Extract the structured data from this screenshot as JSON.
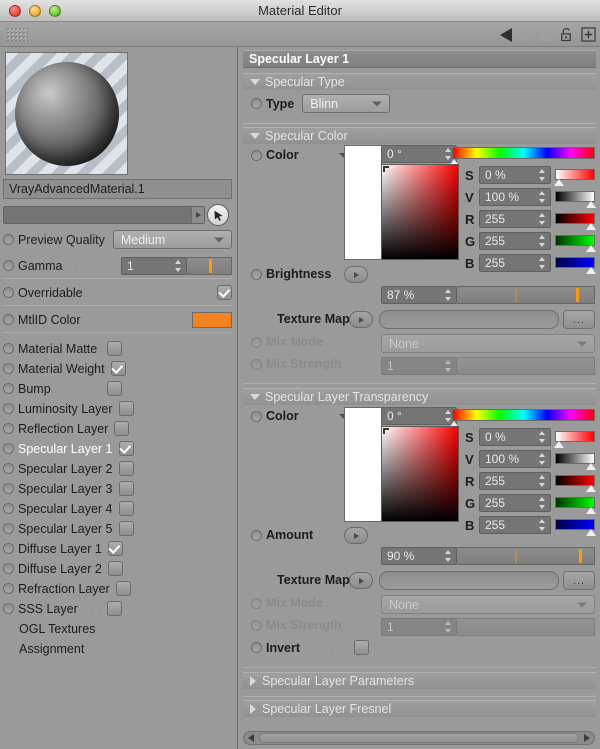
{
  "window": {
    "title": "Material Editor",
    "controls": [
      "close",
      "minimize",
      "zoom"
    ]
  },
  "toolbar": {
    "back_icon": "back-arrow-icon",
    "forward_icon": "forward-arrow-icon",
    "up_icon": "up-arrow-icon",
    "lock_icon": "lock-icon",
    "add_icon": "plus-icon"
  },
  "left_panel": {
    "material_name": "VrayAdvancedMaterial.1",
    "search_placeholder": "",
    "search_value": "",
    "preview_quality": {
      "label": "Preview Quality",
      "value": "Medium"
    },
    "gamma": {
      "label": "Gamma",
      "value": "1"
    },
    "overridable": {
      "label": "Overridable",
      "checked": true
    },
    "mtlid_color": {
      "label": "MtlID Color",
      "color": "#F58220"
    },
    "channels": [
      {
        "label": "Material Matte",
        "checked": false,
        "selected": false
      },
      {
        "label": "Material Weight",
        "checked": true,
        "selected": false
      },
      {
        "label": "Bump",
        "checked": false,
        "selected": false
      },
      {
        "label": "Luminosity Layer",
        "checked": false,
        "selected": false
      },
      {
        "label": "Reflection Layer",
        "checked": false,
        "selected": false
      },
      {
        "label": "Specular Layer 1",
        "checked": true,
        "selected": true
      },
      {
        "label": "Specular Layer 2",
        "checked": false,
        "selected": false
      },
      {
        "label": "Specular Layer 3",
        "checked": false,
        "selected": false
      },
      {
        "label": "Specular Layer 4",
        "checked": false,
        "selected": false
      },
      {
        "label": "Specular Layer 5",
        "checked": false,
        "selected": false
      },
      {
        "label": "Diffuse Layer 1",
        "checked": true,
        "selected": false
      },
      {
        "label": "Diffuse Layer 2",
        "checked": false,
        "selected": false
      },
      {
        "label": "Refraction Layer",
        "checked": false,
        "selected": false
      },
      {
        "label": "SSS Layer",
        "checked": false,
        "selected": false
      }
    ],
    "extras": [
      {
        "label": "OGL Textures"
      },
      {
        "label": "Assignment"
      }
    ]
  },
  "right_panel": {
    "title": "Specular Layer 1",
    "specular_type": {
      "header": "Specular Type",
      "type_label": "Type",
      "type_value": "Blinn"
    },
    "specular_color": {
      "header": "Specular Color",
      "color_label": "Color",
      "hue": "0 °",
      "fields": [
        {
          "key": "S",
          "value": "0 %"
        },
        {
          "key": "V",
          "value": "100 %"
        },
        {
          "key": "R",
          "value": "255"
        },
        {
          "key": "G",
          "value": "255"
        },
        {
          "key": "B",
          "value": "255"
        }
      ],
      "brightness": {
        "label": "Brightness",
        "value": "87 %"
      },
      "texture_map": {
        "label": "Texture Map",
        "value": "",
        "browse_label": "..."
      },
      "mix_mode": {
        "label": "Mix Mode",
        "value": "None"
      },
      "mix_strength": {
        "label": "Mix Strength",
        "value": "1"
      }
    },
    "specular_transparency": {
      "header": "Specular Layer Transparency",
      "color_label": "Color",
      "hue": "0 °",
      "fields": [
        {
          "key": "S",
          "value": "0 %"
        },
        {
          "key": "V",
          "value": "100 %"
        },
        {
          "key": "R",
          "value": "255"
        },
        {
          "key": "G",
          "value": "255"
        },
        {
          "key": "B",
          "value": "255"
        }
      ],
      "amount": {
        "label": "Amount",
        "value": "90 %"
      },
      "texture_map": {
        "label": "Texture Map",
        "value": "",
        "browse_label": "..."
      },
      "mix_mode": {
        "label": "Mix Mode",
        "value": "None"
      },
      "mix_strength": {
        "label": "Mix Strength",
        "value": "1"
      },
      "invert": {
        "label": "Invert",
        "checked": false
      }
    },
    "collapsed_sections": [
      {
        "label": "Specular Layer Parameters"
      },
      {
        "label": "Specular Layer Fresnel"
      }
    ]
  }
}
